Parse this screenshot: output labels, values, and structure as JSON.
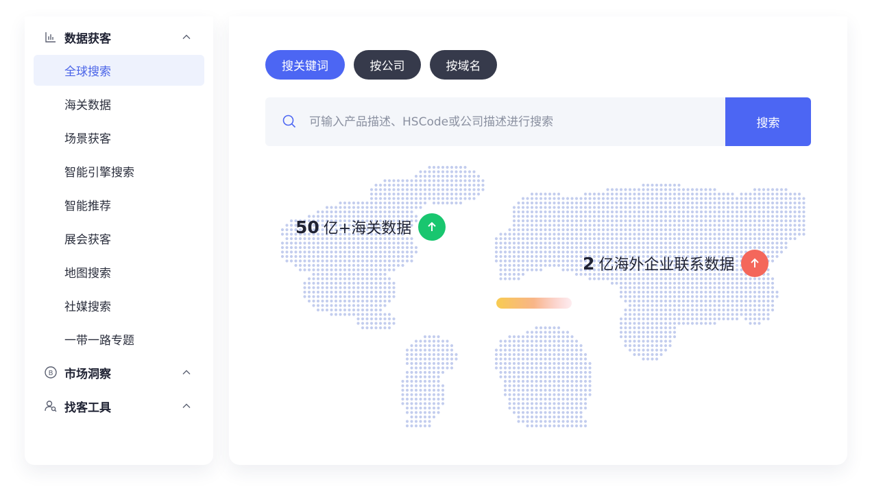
{
  "sidebar": {
    "groups": [
      {
        "label": "数据获客",
        "icon": "bar-chart-icon",
        "items": [
          "全球搜索",
          "海关数据",
          "场景获客",
          "智能引擎搜索",
          "智能推荐",
          "展会获客",
          "地图搜索",
          "社媒搜索",
          "一带一路专题"
        ],
        "active_item": "全球搜索"
      },
      {
        "label": "市场洞察",
        "icon": "b-circle-icon"
      },
      {
        "label": "找客工具",
        "icon": "user-search-icon"
      }
    ]
  },
  "main": {
    "tabs": [
      {
        "label": "搜关键词",
        "active": true
      },
      {
        "label": "按公司",
        "active": false
      },
      {
        "label": "按域名",
        "active": false
      }
    ],
    "search": {
      "placeholder": "可输入产品描述、HSCode或公司描述进行搜索",
      "value": "",
      "button_label": "搜索"
    },
    "stats": [
      {
        "number": "50",
        "text": "亿+海关数据",
        "badge_color": "#19c66f",
        "icon": "arrow-up-icon"
      },
      {
        "number": "2",
        "text": "亿海外企业联系数据",
        "badge_color": "#f4675b",
        "icon": "arrow-up-icon"
      }
    ]
  },
  "colors": {
    "accent": "#4c66f3",
    "active_bg": "#eef2fd",
    "dark_pill": "#363a4b",
    "map_dot": "#c3cdee"
  }
}
